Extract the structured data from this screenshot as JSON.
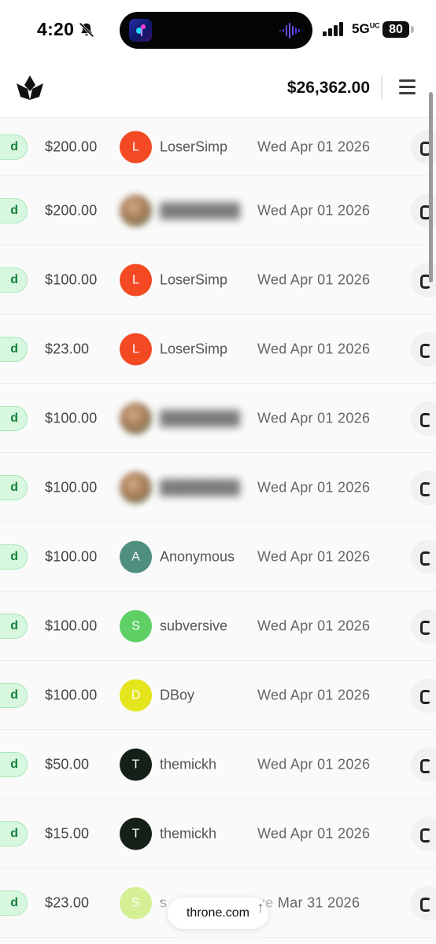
{
  "status_bar": {
    "time": "4:20",
    "network": "5G",
    "network_suffix": "UC",
    "battery": "80"
  },
  "header": {
    "balance": "$26,362.00"
  },
  "colors": {
    "status_chip_bg": "#d7f7de",
    "status_chip_text": "#14803a",
    "avatar_L": "#f34a24",
    "avatar_A": "#4e8f80",
    "avatar_S": "#5ed065",
    "avatar_D": "#e4e51d",
    "avatar_T": "#142018",
    "avatar_S_light": "#d5ef94"
  },
  "rows": [
    {
      "status": "d",
      "amount": "$200.00",
      "avatar": "L",
      "user": "LoserSimp",
      "date": "Wed Apr 01 2026",
      "avatar_color": "#f34a24",
      "blurred": false
    },
    {
      "status": "d",
      "amount": "$200.00",
      "avatar": "",
      "user": "",
      "date": "Wed Apr 01 2026",
      "avatar_color": "",
      "blurred": true
    },
    {
      "status": "d",
      "amount": "$100.00",
      "avatar": "L",
      "user": "LoserSimp",
      "date": "Wed Apr 01 2026",
      "avatar_color": "#f34a24",
      "blurred": false
    },
    {
      "status": "d",
      "amount": "$23.00",
      "avatar": "L",
      "user": "LoserSimp",
      "date": "Wed Apr 01 2026",
      "avatar_color": "#f34a24",
      "blurred": false
    },
    {
      "status": "d",
      "amount": "$100.00",
      "avatar": "",
      "user": "",
      "date": "Wed Apr 01 2026",
      "avatar_color": "",
      "blurred": true
    },
    {
      "status": "d",
      "amount": "$100.00",
      "avatar": "",
      "user": "",
      "date": "Wed Apr 01 2026",
      "avatar_color": "",
      "blurred": true
    },
    {
      "status": "d",
      "amount": "$100.00",
      "avatar": "A",
      "user": "Anonymous",
      "date": "Wed Apr 01 2026",
      "avatar_color": "#4e8f80",
      "blurred": false
    },
    {
      "status": "d",
      "amount": "$100.00",
      "avatar": "S",
      "user": "subversive",
      "date": "Wed Apr 01 2026",
      "avatar_color": "#5ed065",
      "blurred": false
    },
    {
      "status": "d",
      "amount": "$100.00",
      "avatar": "D",
      "user": "DBoy",
      "date": "Wed Apr 01 2026",
      "avatar_color": "#e4e51d",
      "blurred": false
    },
    {
      "status": "d",
      "amount": "$50.00",
      "avatar": "T",
      "user": "themickh",
      "date": "Wed Apr 01 2026",
      "avatar_color": "#142018",
      "blurred": false
    },
    {
      "status": "d",
      "amount": "$15.00",
      "avatar": "T",
      "user": "themickh",
      "date": "Wed Apr 01 2026",
      "avatar_color": "#142018",
      "blurred": false
    },
    {
      "status": "d",
      "amount": "$23.00",
      "avatar": "S",
      "user": "s",
      "date": "ue Mar 31 2026",
      "avatar_color": "#d5ef94",
      "blurred": false
    }
  ],
  "browser": {
    "url": "throne.com"
  }
}
